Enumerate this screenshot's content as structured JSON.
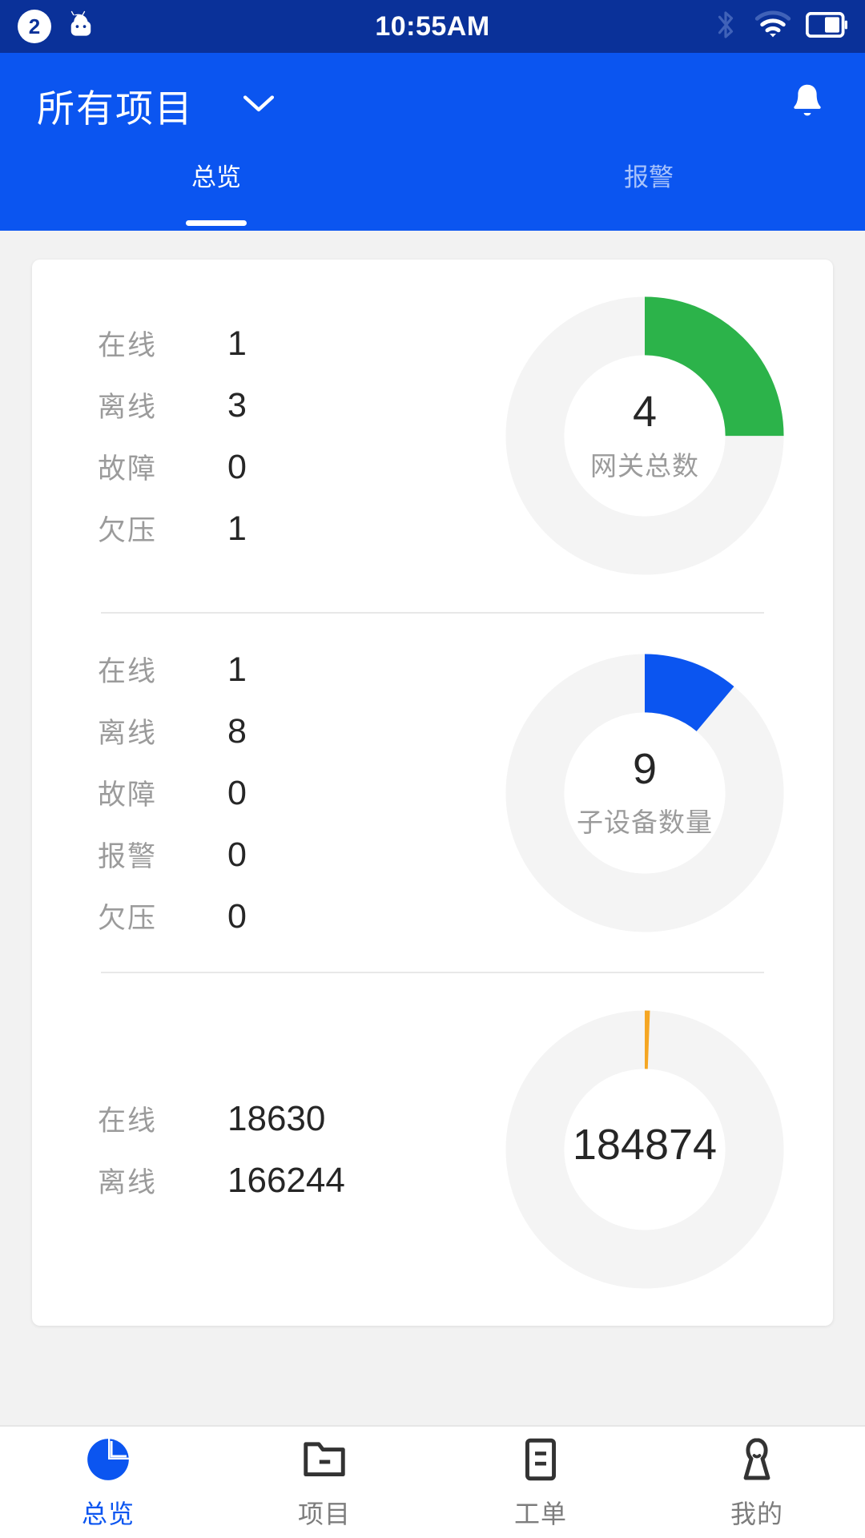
{
  "statusbar": {
    "notification_count": "2",
    "time": "10:55AM",
    "icons": [
      "android-icon",
      "bluetooth-icon",
      "wifi-icon",
      "battery-icon"
    ]
  },
  "header": {
    "project_title": "所有项目",
    "dropdown_icon": "chevron-down-icon",
    "bell_icon": "bell-icon",
    "tabs": [
      {
        "label": "总览",
        "active": true
      },
      {
        "label": "报警",
        "active": false
      }
    ]
  },
  "colors": {
    "statusbar_bg": "#0a3199",
    "header_bg": "#0b55f0",
    "accent": "#0b55f0",
    "green": "#2cb34a",
    "orange": "#f5a623",
    "track": "#f4f4f4",
    "page_bg": "#f2f2f2"
  },
  "blocks": [
    {
      "rows": [
        {
          "label": "在线",
          "value": "1"
        },
        {
          "label": "离线",
          "value": "3"
        },
        {
          "label": "故障",
          "value": "0"
        },
        {
          "label": "欠压",
          "value": "1"
        }
      ],
      "donut": {
        "total": "4",
        "caption": "网关总数",
        "percent": 25,
        "color": "#2cb34a"
      }
    },
    {
      "rows": [
        {
          "label": "在线",
          "value": "1"
        },
        {
          "label": "离线",
          "value": "8"
        },
        {
          "label": "故障",
          "value": "0"
        },
        {
          "label": "报警",
          "value": "0"
        },
        {
          "label": "欠压",
          "value": "0"
        }
      ],
      "donut": {
        "total": "9",
        "caption": "子设备数量",
        "percent": 11.1,
        "color": "#0b55f0"
      }
    },
    {
      "rows": [
        {
          "label": "在线",
          "value": "18630"
        },
        {
          "label": "离线",
          "value": "166244"
        }
      ],
      "donut": {
        "total": "184874",
        "caption": "",
        "percent": 0.6,
        "color": "#f5a623"
      }
    }
  ],
  "bottomnav": [
    {
      "label": "总览",
      "icon": "pie-chart-icon",
      "active": true
    },
    {
      "label": "项目",
      "icon": "folder-icon",
      "active": false
    },
    {
      "label": "工单",
      "icon": "clipboard-icon",
      "active": false
    },
    {
      "label": "我的",
      "icon": "person-icon",
      "active": false
    }
  ]
}
